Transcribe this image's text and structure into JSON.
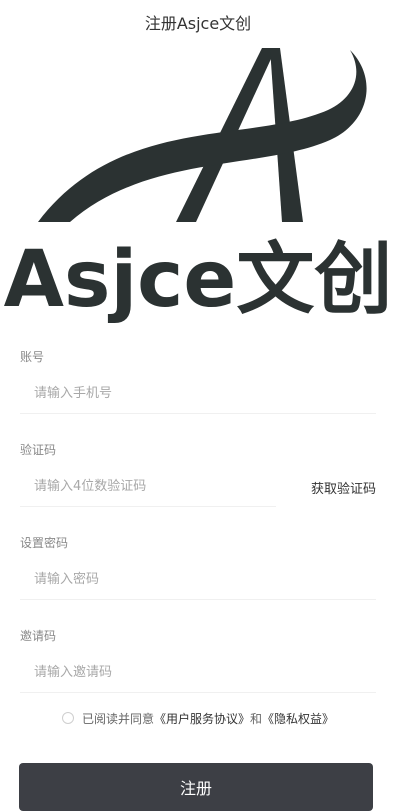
{
  "page": {
    "title": "注册Asjce文创"
  },
  "logo": {
    "text": "Asjce文创",
    "color": "#2b3232"
  },
  "form": {
    "account": {
      "label": "账号",
      "placeholder": "请输入手机号"
    },
    "code": {
      "label": "验证码",
      "placeholder": "请输入4位数验证码",
      "button_label": "获取验证码"
    },
    "password": {
      "label": "设置密码",
      "placeholder": "请输入密码"
    },
    "invite": {
      "label": "邀请码",
      "placeholder": "请输入邀请码"
    }
  },
  "agreement": {
    "prefix": "已阅读并同意",
    "service_link": "《用户服务协议》",
    "and": "和",
    "privacy_link": "《隐私权益》"
  },
  "submit": {
    "label": "注册",
    "color": "#3d3f45"
  }
}
